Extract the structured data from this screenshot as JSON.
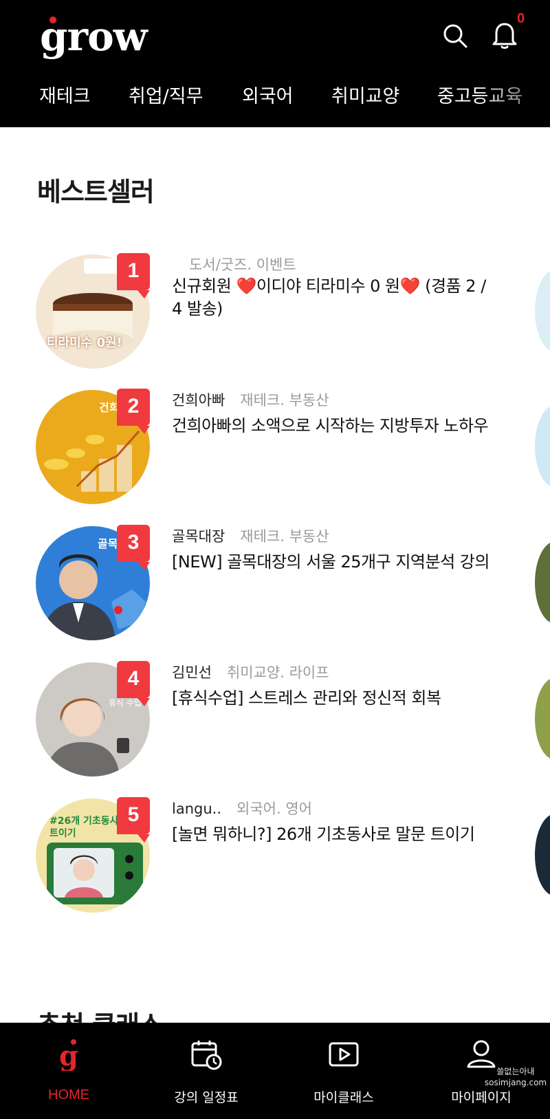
{
  "header": {
    "logo": "grow",
    "notification_count": "0",
    "nav": [
      "재테크",
      "취업/직무",
      "외국어",
      "취미교양",
      "중고등교육"
    ]
  },
  "bestseller": {
    "title": "베스트셀러",
    "items": [
      {
        "rank": "1",
        "author": "",
        "category": "도서/굿즈. 이벤트",
        "title": "신규회원 ❤️이디야 티라미수  0 원❤️ (경품 2 / 4 발송)",
        "thumb_text": "티라미수 0원!"
      },
      {
        "rank": "2",
        "author": "건희아빠",
        "category": "재테크. 부동산",
        "title": "건희아빠의 소액으로 시작하는 지방투자 노하우",
        "thumb_text": "건희"
      },
      {
        "rank": "3",
        "author": "골목대장",
        "category": "재테크. 부동산",
        "title": "[NEW] 골목대장의 서울 25개구 지역분석 강의",
        "thumb_text": "골목"
      },
      {
        "rank": "4",
        "author": "김민선",
        "category": "취미교양. 라이프",
        "title": "[휴식수업] 스트레스 관리와 정신적 회복",
        "thumb_text": "휴식 수업"
      },
      {
        "rank": "5",
        "author": "langu..",
        "category": "외국어. 영어",
        "title": "[놀면 뭐하니?] 26개 기초동사로 말문 트이기",
        "thumb_text": "#26개 기초동사 말문 트이기"
      }
    ]
  },
  "next_section_title": "추천 클래스",
  "bottom_nav": [
    {
      "label": "HOME",
      "icon": "home-g-icon",
      "active": true
    },
    {
      "label": "강의 일정표",
      "icon": "calendar-clock-icon",
      "active": false
    },
    {
      "label": "마이클래스",
      "icon": "play-card-icon",
      "active": false
    },
    {
      "label": "마이페이지",
      "icon": "person-icon",
      "active": false
    }
  ],
  "watermark": "쓸없는아내 sosimjang.com",
  "colors": {
    "accent": "#e8232b",
    "header_bg": "#000000",
    "rank_badge": "#f03a3f"
  }
}
